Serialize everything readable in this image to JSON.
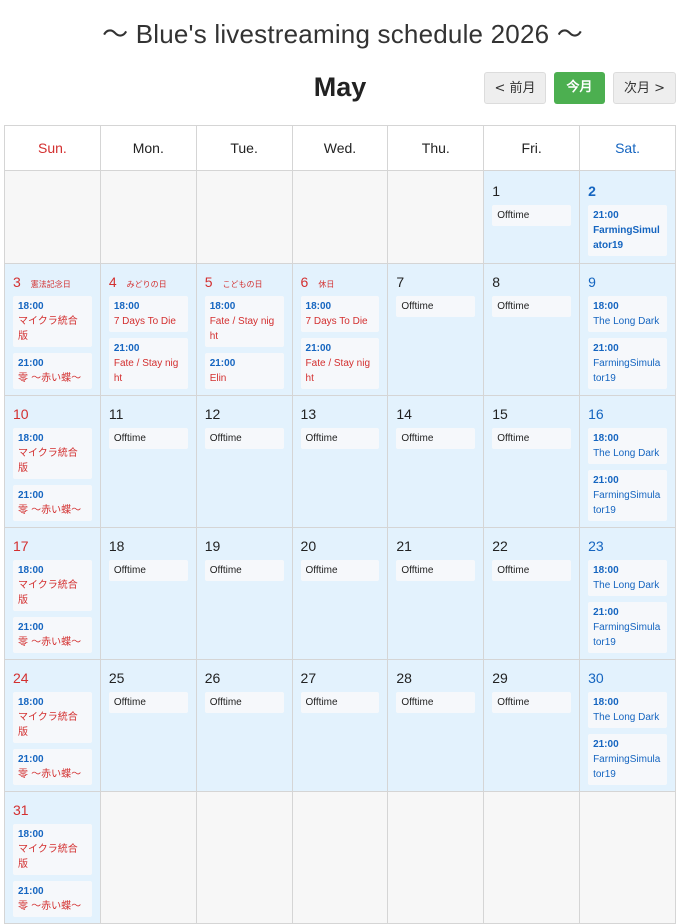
{
  "page_title": "〜 Blue's livestreaming schedule 2026 〜",
  "month": "May",
  "nav": {
    "prev": "< 前月",
    "today": "今月",
    "next": "次月 >"
  },
  "weekdays": [
    "Sun.",
    "Mon.",
    "Tue.",
    "Wed.",
    "Thu.",
    "Fri.",
    "Sat."
  ],
  "holidays": {
    "3": "憲法記念日",
    "4": "みどりの日",
    "5": "こどもの日",
    "6": "休日"
  },
  "offtime_label": "Offtime",
  "events": {
    "sat1": [
      {
        "time": "21:00",
        "title": "FarmingSimulator19"
      }
    ],
    "sun3": [
      {
        "time": "18:00",
        "title": "マイクラ統合版"
      },
      {
        "time": "21:00",
        "title": "零 〜赤い蝶〜"
      }
    ],
    "mon4": [
      {
        "time": "18:00",
        "title": "7 Days To Die"
      },
      {
        "time": "21:00",
        "title": "Fate / Stay night"
      }
    ],
    "tue5": [
      {
        "time": "18:00",
        "title": "Fate / Stay night"
      },
      {
        "time": "21:00",
        "title": "Elin"
      }
    ],
    "wed6": [
      {
        "time": "18:00",
        "title": "7 Days To Die"
      },
      {
        "time": "21:00",
        "title": "Fate / Stay night"
      }
    ],
    "sun": [
      {
        "time": "18:00",
        "title": "マイクラ統合版"
      },
      {
        "time": "21:00",
        "title": "零 〜赤い蝶〜"
      }
    ],
    "sat": [
      {
        "time": "18:00",
        "title": "The Long Dark"
      },
      {
        "time": "21:00",
        "title": "FarmingSimulator19"
      }
    ]
  },
  "days": {
    "1": "1",
    "2": "2",
    "3": "3",
    "4": "4",
    "5": "5",
    "6": "6",
    "7": "7",
    "8": "8",
    "9": "9",
    "10": "10",
    "11": "11",
    "12": "12",
    "13": "13",
    "14": "14",
    "15": "15",
    "16": "16",
    "17": "17",
    "18": "18",
    "19": "19",
    "20": "20",
    "21": "21",
    "22": "22",
    "23": "23",
    "24": "24",
    "25": "25",
    "26": "26",
    "27": "27",
    "28": "28",
    "29": "29",
    "30": "30",
    "31": "31"
  }
}
